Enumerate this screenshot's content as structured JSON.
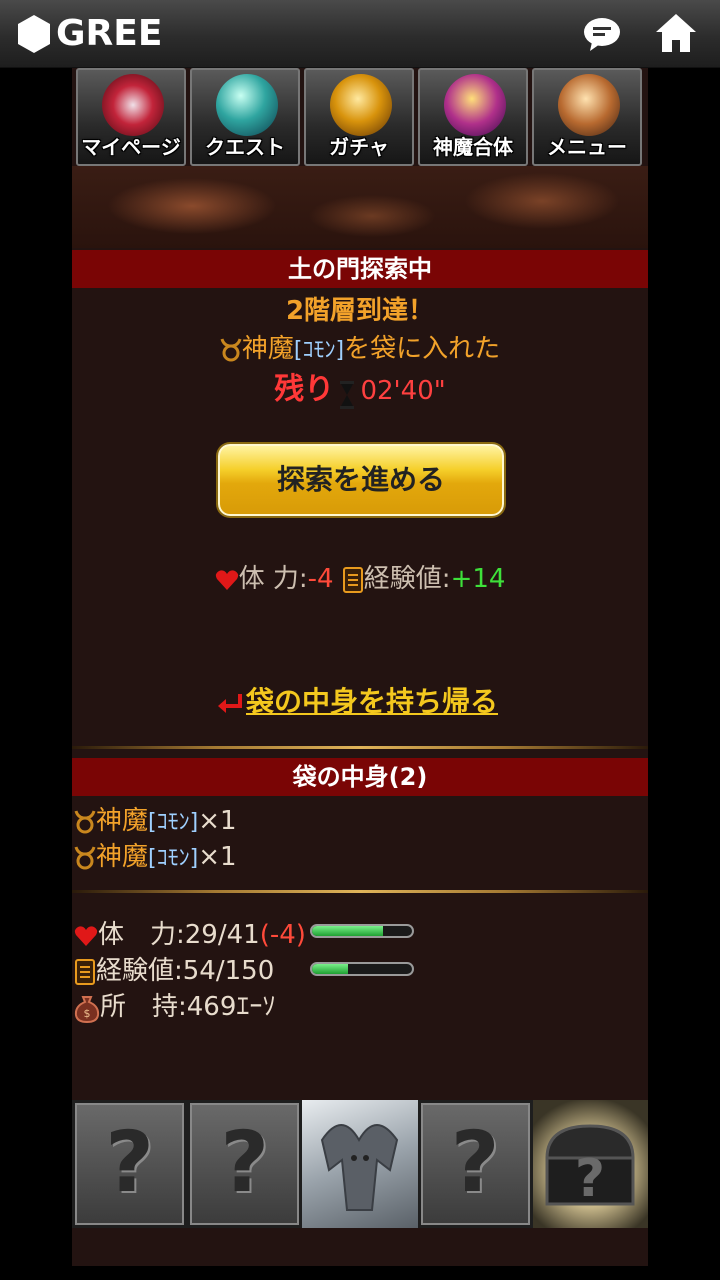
{
  "topbar": {
    "brand": "GREE"
  },
  "nav": [
    {
      "label": "マイページ",
      "icon": "mypage-crest-icon"
    },
    {
      "label": "クエスト",
      "icon": "quest-potion-icon"
    },
    {
      "label": "ガチャ",
      "icon": "gacha-orb-icon"
    },
    {
      "label": "神魔合体",
      "icon": "fusion-orb-icon"
    },
    {
      "label": "メニュー",
      "icon": "menu-cards-icon"
    }
  ],
  "explore": {
    "header": "土の門探索中",
    "floor_reached": "2階層到達！",
    "item_prefix": "神魔",
    "item_rarity": "[ｺﾓﾝ]",
    "item_suffix": "を袋に入れた",
    "remaining_label": "残り",
    "remaining_time": "02'40\"",
    "advance_button": "探索を進める",
    "stamina_label": "体 力:",
    "stamina_delta": "-4",
    "exp_label": "経験値:",
    "exp_delta": "+14",
    "return_link": "袋の中身を持ち帰る"
  },
  "bag": {
    "header": "袋の中身(2)",
    "items": [
      {
        "name": "神魔",
        "rarity": "[ｺﾓﾝ]",
        "count": "×1"
      },
      {
        "name": "神魔",
        "rarity": "[ｺﾓﾝ]",
        "count": "×1"
      }
    ]
  },
  "status": {
    "stamina_label": "体　力:",
    "stamina_value": "29/41",
    "stamina_change": "(-4)",
    "stamina_fraction": 0.707,
    "exp_label": "経験値:",
    "exp_value": "54/150",
    "exp_fraction": 0.36,
    "money_label": "所　持:",
    "money_value": "469ｴｰｿ"
  },
  "colors": {
    "header_red": "#7a0505",
    "accent_orange": "#f2a22a",
    "link_yellow": "#f4c81e",
    "negative": "#ff4a3a",
    "positive": "#3ee03a"
  }
}
